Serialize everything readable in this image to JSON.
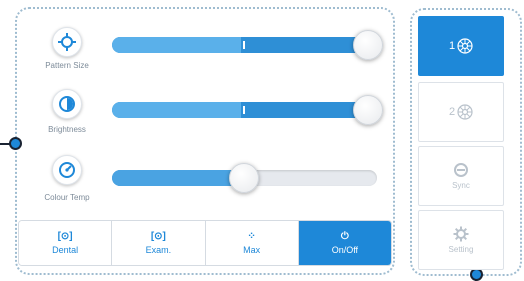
{
  "controls": [
    {
      "label": "Pattern Size",
      "icon": "pattern-size-icon",
      "value_percent": 100
    },
    {
      "label": "Brightness",
      "icon": "brightness-icon",
      "value_percent": 100
    },
    {
      "label": "Colour Temp",
      "icon": "colour-temp-icon",
      "value_percent": 50
    }
  ],
  "modes": [
    {
      "label": "Dental",
      "glyph": "[⊙]",
      "active": false
    },
    {
      "label": "Exam.",
      "glyph": "[⊙]",
      "active": false
    },
    {
      "label": "Max",
      "glyph": "⁘",
      "active": false
    },
    {
      "label": "On/Off",
      "glyph": "⏻",
      "active": true
    }
  ],
  "side": [
    {
      "number": "1",
      "label": "",
      "icon": "light-head-icon",
      "active": true
    },
    {
      "number": "2",
      "label": "",
      "icon": "light-head-icon",
      "active": false
    },
    {
      "number": "",
      "label": "Sync",
      "icon": "sync-icon",
      "active": false
    },
    {
      "number": "",
      "label": "Setting",
      "icon": "gear-icon",
      "active": false
    }
  ],
  "colors": {
    "accent": "#1e88d8",
    "accent_light": "#5ab0ea",
    "callout": "#1a2332"
  }
}
